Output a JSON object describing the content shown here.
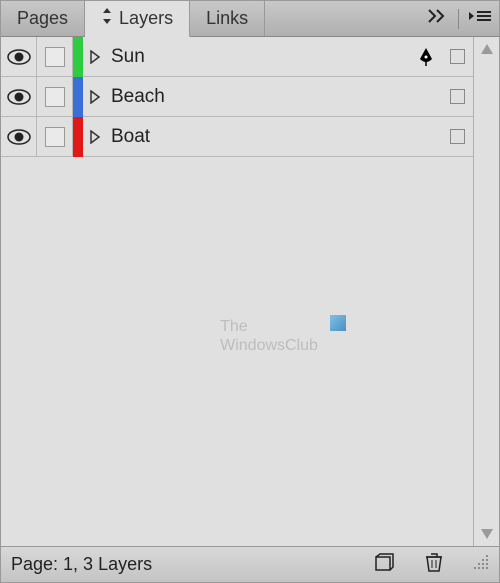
{
  "tabs": {
    "pages": "Pages",
    "layers": "Layers",
    "links": "Links"
  },
  "layers": [
    {
      "name": "Sun",
      "color": "#2ecc40",
      "has_pen": true
    },
    {
      "name": "Beach",
      "color": "#3a6fd8",
      "has_pen": false
    },
    {
      "name": "Boat",
      "color": "#e01818",
      "has_pen": false
    }
  ],
  "status": "Page: 1, 3 Layers",
  "watermark": {
    "line1": "The",
    "line2": "WindowsClub"
  }
}
